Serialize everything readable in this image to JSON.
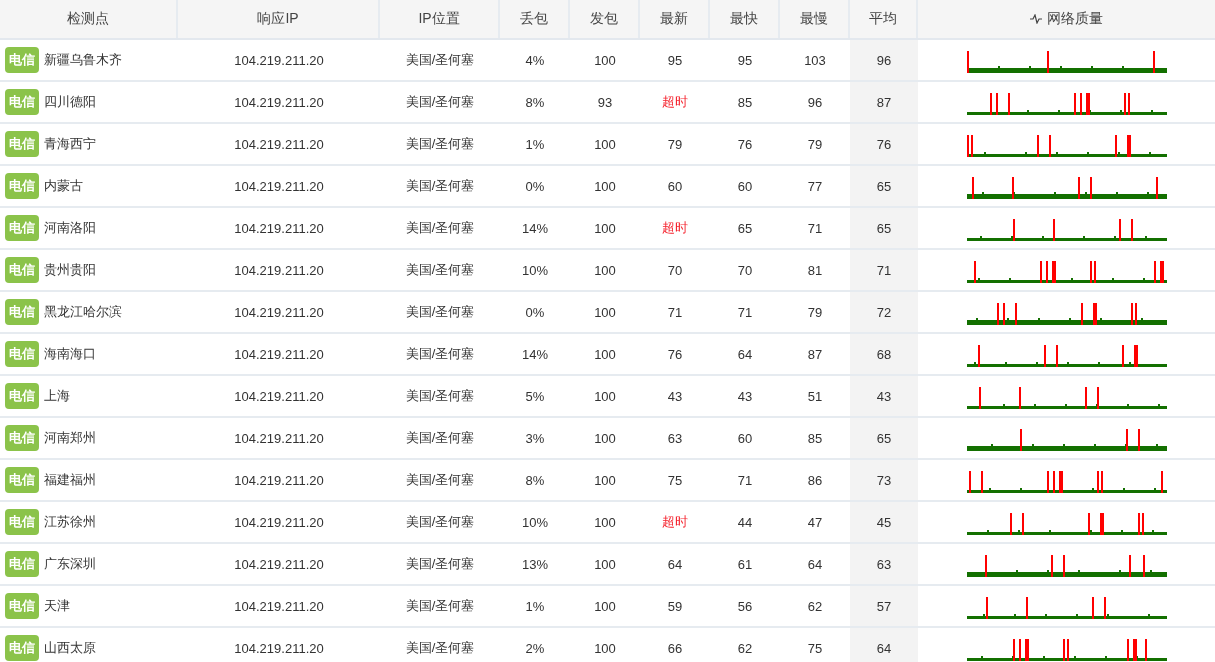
{
  "table": {
    "columns": [
      "检测点",
      "响应IP",
      "IP位置",
      "丢包",
      "发包",
      "最新",
      "最快",
      "最慢",
      "平均",
      "网络质量"
    ],
    "rows": [
      {
        "isp": "电信",
        "node": "新疆乌鲁木齐",
        "ip": "104.219.211.20",
        "location": "美国/圣何塞",
        "loss": "4%",
        "sent": "100",
        "latest": "95",
        "latest_timeout": false,
        "fastest": "95",
        "slowest": "103",
        "average": "96"
      },
      {
        "isp": "电信",
        "node": "四川德阳",
        "ip": "104.219.211.20",
        "location": "美国/圣何塞",
        "loss": "8%",
        "sent": "93",
        "latest": "超时",
        "latest_timeout": true,
        "fastest": "85",
        "slowest": "96",
        "average": "87"
      },
      {
        "isp": "电信",
        "node": "青海西宁",
        "ip": "104.219.211.20",
        "location": "美国/圣何塞",
        "loss": "1%",
        "sent": "100",
        "latest": "79",
        "latest_timeout": false,
        "fastest": "76",
        "slowest": "79",
        "average": "76"
      },
      {
        "isp": "电信",
        "node": "内蒙古",
        "ip": "104.219.211.20",
        "location": "美国/圣何塞",
        "loss": "0%",
        "sent": "100",
        "latest": "60",
        "latest_timeout": false,
        "fastest": "60",
        "slowest": "77",
        "average": "65"
      },
      {
        "isp": "电信",
        "node": "河南洛阳",
        "ip": "104.219.211.20",
        "location": "美国/圣何塞",
        "loss": "14%",
        "sent": "100",
        "latest": "超时",
        "latest_timeout": true,
        "fastest": "65",
        "slowest": "71",
        "average": "65"
      },
      {
        "isp": "电信",
        "node": "贵州贵阳",
        "ip": "104.219.211.20",
        "location": "美国/圣何塞",
        "loss": "10%",
        "sent": "100",
        "latest": "70",
        "latest_timeout": false,
        "fastest": "70",
        "slowest": "81",
        "average": "71"
      },
      {
        "isp": "电信",
        "node": "黑龙江哈尔滨",
        "ip": "104.219.211.20",
        "location": "美国/圣何塞",
        "loss": "0%",
        "sent": "100",
        "latest": "71",
        "latest_timeout": false,
        "fastest": "71",
        "slowest": "79",
        "average": "72"
      },
      {
        "isp": "电信",
        "node": "海南海口",
        "ip": "104.219.211.20",
        "location": "美国/圣何塞",
        "loss": "14%",
        "sent": "100",
        "latest": "76",
        "latest_timeout": false,
        "fastest": "64",
        "slowest": "87",
        "average": "68"
      },
      {
        "isp": "电信",
        "node": "上海",
        "ip": "104.219.211.20",
        "location": "美国/圣何塞",
        "loss": "5%",
        "sent": "100",
        "latest": "43",
        "latest_timeout": false,
        "fastest": "43",
        "slowest": "51",
        "average": "43"
      },
      {
        "isp": "电信",
        "node": "河南郑州",
        "ip": "104.219.211.20",
        "location": "美国/圣何塞",
        "loss": "3%",
        "sent": "100",
        "latest": "63",
        "latest_timeout": false,
        "fastest": "60",
        "slowest": "85",
        "average": "65"
      },
      {
        "isp": "电信",
        "node": "福建福州",
        "ip": "104.219.211.20",
        "location": "美国/圣何塞",
        "loss": "8%",
        "sent": "100",
        "latest": "75",
        "latest_timeout": false,
        "fastest": "71",
        "slowest": "86",
        "average": "73"
      },
      {
        "isp": "电信",
        "node": "江苏徐州",
        "ip": "104.219.211.20",
        "location": "美国/圣何塞",
        "loss": "10%",
        "sent": "100",
        "latest": "超时",
        "latest_timeout": true,
        "fastest": "44",
        "slowest": "47",
        "average": "45"
      },
      {
        "isp": "电信",
        "node": "广东深圳",
        "ip": "104.219.211.20",
        "location": "美国/圣何塞",
        "loss": "13%",
        "sent": "100",
        "latest": "64",
        "latest_timeout": false,
        "fastest": "61",
        "slowest": "64",
        "average": "63"
      },
      {
        "isp": "电信",
        "node": "天津",
        "ip": "104.219.211.20",
        "location": "美国/圣何塞",
        "loss": "1%",
        "sent": "100",
        "latest": "59",
        "latest_timeout": false,
        "fastest": "56",
        "slowest": "62",
        "average": "57"
      },
      {
        "isp": "电信",
        "node": "山西太原",
        "ip": "104.219.211.20",
        "location": "美国/圣何塞",
        "loss": "2%",
        "sent": "100",
        "latest": "66",
        "latest_timeout": false,
        "fastest": "62",
        "slowest": "75",
        "average": "64"
      }
    ]
  }
}
